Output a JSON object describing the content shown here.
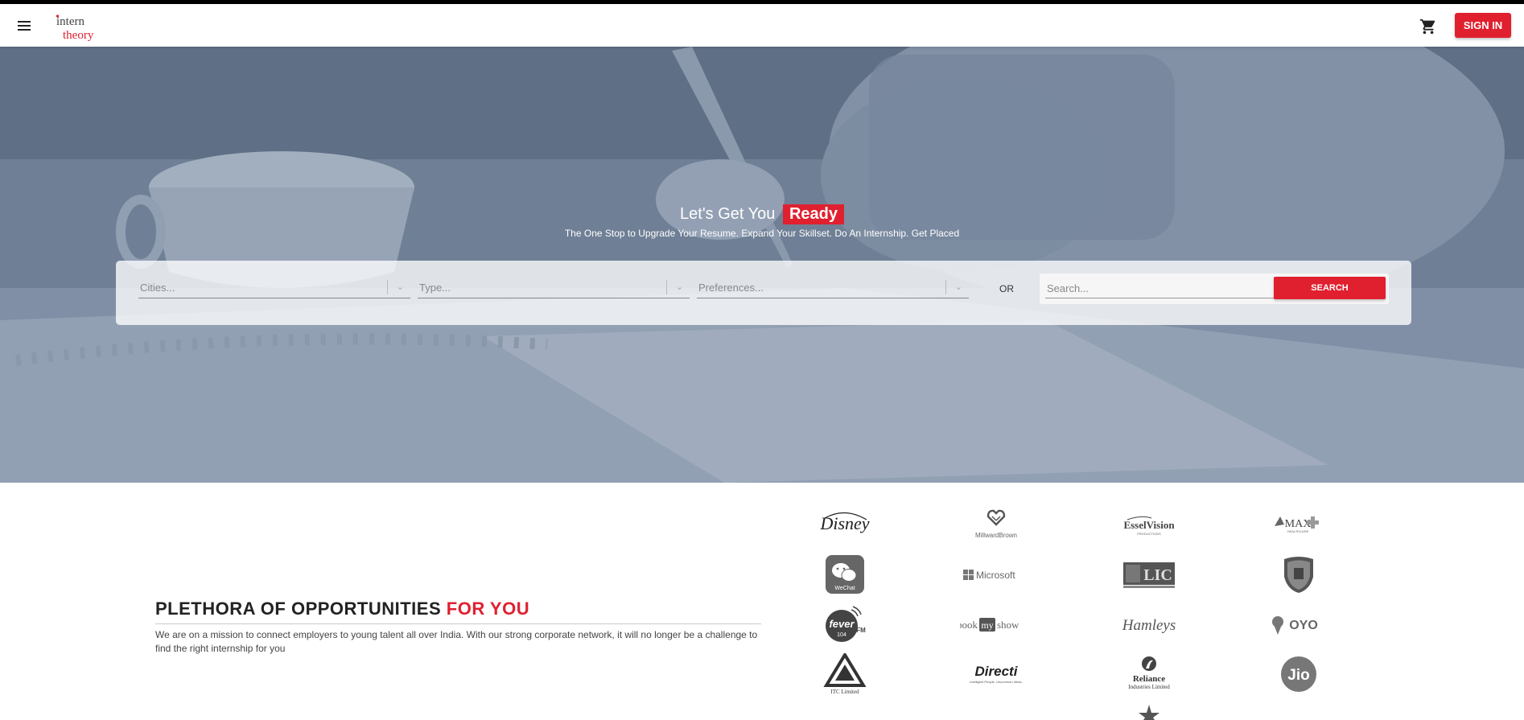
{
  "app": {
    "logo_text_1": "intern",
    "logo_text_2": "theory"
  },
  "header": {
    "menu_icon": "hamburger-menu-icon",
    "cart_icon": "shopping-cart-icon",
    "signin_label": "SIGN IN"
  },
  "hero": {
    "title_prefix": "Let's Get You",
    "title_highlight": "Ready",
    "subtitle": "The One Stop to Upgrade Your Resume. Expand Your Skillset. Do An Internship. Get Placed"
  },
  "search": {
    "cities_placeholder": "Cities...",
    "type_placeholder": "Type...",
    "preferences_placeholder": "Preferences...",
    "or_label": "OR",
    "search_placeholder": "Search...",
    "search_button": "SEARCH"
  },
  "section": {
    "heading_main": "PLETHORA OF OPPORTUNITIES",
    "heading_highlight": "FOR YOU",
    "description": "We are on a mission to connect employers to young talent all over India. With our strong corporate network, it will no longer be a challenge to find the right internship for you"
  },
  "partners": {
    "disney": "Disney",
    "millward": "MillwardBrown",
    "essel": "EsselVision",
    "essel_sub": "PRODUCTIONS",
    "max": "MAX",
    "max_sub": "HEALTHCARE",
    "wechat": "WeChat",
    "microsoft": "Microsoft",
    "lic": "LIC",
    "fever": "fever",
    "fever_num": "104",
    "fever_fm": "FM",
    "bookmyshow_1": "book",
    "bookmyshow_2": "my",
    "bookmyshow_3": "show",
    "hamleys": "Hamleys",
    "oyo": "OYO",
    "itc": "ITC Limited",
    "directi": "Directi",
    "directi_sub": "intelligent People. Uncommon Ideas.",
    "reliance": "Reliance",
    "reliance_sub": "Industries Limited",
    "jio": "Jio"
  },
  "colors": {
    "accent": "#e0202f",
    "hero_overlay": "#6d7d92"
  }
}
